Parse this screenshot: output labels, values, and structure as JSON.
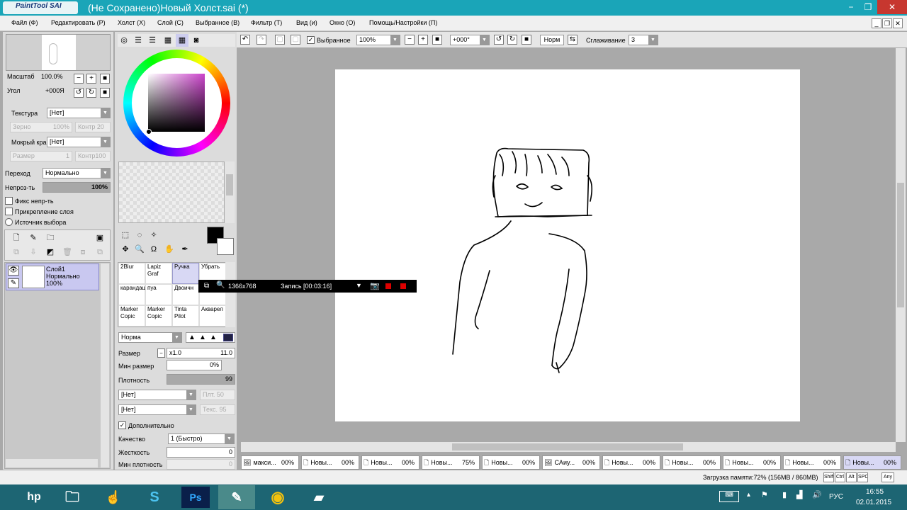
{
  "window": {
    "logo_text": "PaintTool SAI",
    "title": "(Не Сохранено)Новый Холст.sai (*)",
    "min": "−",
    "max": "❐",
    "close": "✕"
  },
  "menu": [
    "Файл (Ф)",
    "Редактировать (Р)",
    "Холст (Х)",
    "Слой (С)",
    "Выбранное (В)",
    "Фильтр (Т)",
    "Вид (и)",
    "Окно (О)",
    "Помощь/Настройки (П)"
  ],
  "nav": {
    "zoom_label": "Масштаб",
    "zoom_value": "100.0%",
    "angle_label": "Угол",
    "angle_value": "+000Я"
  },
  "texture": {
    "label": "Текстура",
    "value": "[Нет]",
    "grain_label": "Зерно",
    "grain_value": "100%",
    "contrast": "Контр 20"
  },
  "wet_edge": {
    "label": "Мокрый край",
    "value": "[Нет]",
    "size_label": "Размер",
    "size_value": "1",
    "contrast": "Контр100"
  },
  "blend": {
    "label": "Переход",
    "value": "Нормально"
  },
  "opacity": {
    "label": "Непроз-ть",
    "value": "100%"
  },
  "checks": [
    "Фикс непр-ть",
    "Прикрепление слоя",
    "Источник выбора"
  ],
  "layer": {
    "name": "Слой1",
    "mode": "Нормально",
    "opacity": "100%"
  },
  "toolbar": {
    "selection_label": "Выбранное",
    "zoom": "100%",
    "angle": "+000°",
    "mode_btn": "Норм",
    "smoothing_label": "Сглаживание",
    "smoothing_value": "3"
  },
  "brushes": [
    "2Blur",
    "Lapiz Graf",
    "Ручка",
    "Убрать",
    "карандаш",
    "пуа",
    "Двоичн",
    "",
    "Marker Copic",
    "Marker Copic",
    "Tinta Pilot",
    "Акварел"
  ],
  "brush_settings": {
    "mode": "Норма",
    "size_label": "Размер",
    "size_mult": "x1.0",
    "size_value": "11.0",
    "min_size_label": "Мин размер",
    "min_size_value": "0%",
    "density_label": "Плотность",
    "density_value": "99",
    "tex1": "[Нет]",
    "tex1_r": "Плт. 50",
    "tex2": "[Нет]",
    "tex2_r": "Текс. 95",
    "extra_label": "Дополнительно",
    "quality_label": "Качество",
    "quality_value": "1 (Быстро)",
    "hard_label": "Жесткость",
    "hard_value": "0",
    "min_density_label": "Мин плотность",
    "min_density_value": "0"
  },
  "recorder": {
    "size": "1366x768",
    "status": "Запись [00:03:16]"
  },
  "tabs": [
    {
      "name": "макси...",
      "pct": "00%"
    },
    {
      "name": "Новы...",
      "pct": "00%"
    },
    {
      "name": "Новы...",
      "pct": "00%"
    },
    {
      "name": "Новы...",
      "pct": "75%"
    },
    {
      "name": "Новы...",
      "pct": "00%"
    },
    {
      "name": "CАиу...",
      "pct": "00%"
    },
    {
      "name": "Новы...",
      "pct": "00%"
    },
    {
      "name": "Новы...",
      "pct": "00%"
    },
    {
      "name": "Новы...",
      "pct": "00%"
    },
    {
      "name": "Новы...",
      "pct": "00%"
    },
    {
      "name": "Новы...",
      "pct": "00%"
    }
  ],
  "status": {
    "memory": "Загрузка памяти:72% (156MB / 860MB)",
    "keys": [
      "Shift",
      "Ctrl",
      "Alt",
      "SPC"
    ],
    "any": "Any"
  },
  "taskbar": {
    "lang": "РУС",
    "time": "16:55",
    "date": "02.01.2015",
    "apps": [
      "hp",
      "files",
      "cursor",
      "skype",
      "Ps",
      "sai",
      "chrome",
      "notes"
    ]
  }
}
